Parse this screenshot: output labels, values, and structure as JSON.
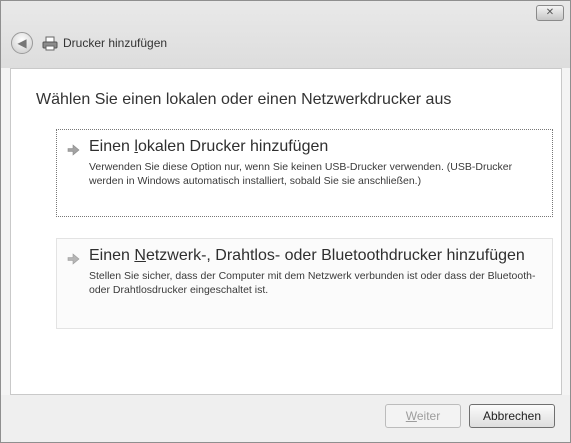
{
  "window": {
    "title": "Drucker hinzufügen",
    "close_symbol": "✕"
  },
  "nav": {
    "back_symbol": "◀"
  },
  "main": {
    "heading": "Wählen Sie einen lokalen oder einen Netzwerkdrucker aus",
    "options": [
      {
        "title_before": "Einen ",
        "title_underline": "l",
        "title_after": "okalen Drucker hinzufügen",
        "description": "Verwenden Sie diese Option nur, wenn Sie keinen USB-Drucker verwenden. (USB-Drucker werden in Windows automatisch installiert, sobald Sie sie anschließen.)"
      },
      {
        "title_before": "Einen ",
        "title_underline": "N",
        "title_after": "etzwerk-, Drahtlos- oder Bluetoothdrucker hinzufügen",
        "description": "Stellen Sie sicher, dass der Computer mit dem Netzwerk verbunden ist oder dass der Bluetooth- oder Drahtlosdrucker eingeschaltet ist."
      }
    ]
  },
  "footer": {
    "next_underline": "W",
    "next_rest": "eiter",
    "cancel_label": "Abbrechen"
  },
  "icons": {
    "close": "close-icon",
    "back": "back-arrow-icon",
    "printer": "printer-icon",
    "option_arrow": "arrow-right-icon"
  },
  "colors": {
    "chrome": "#e3e3e3",
    "content_bg": "#ffffff",
    "arrow": "#9a9a9a",
    "disabled_text": "#9d9d9d"
  }
}
